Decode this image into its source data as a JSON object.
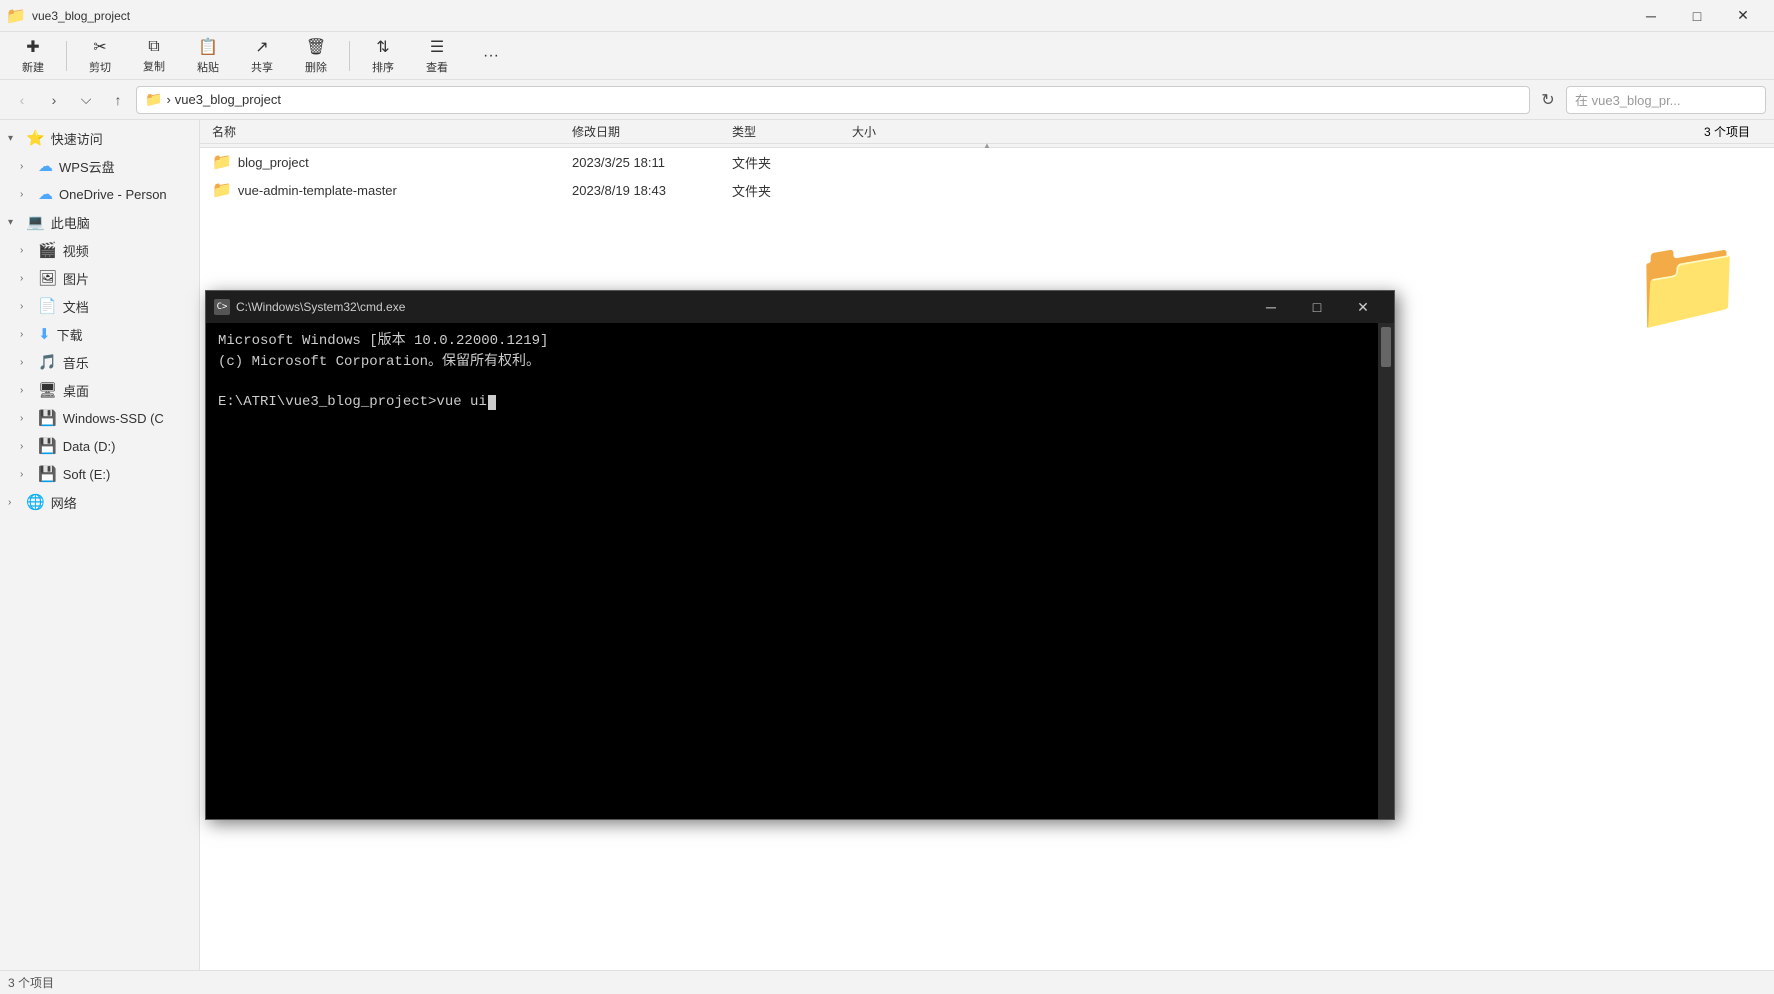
{
  "window": {
    "title": "vue3_blog_project",
    "titlebar_icon": "📁"
  },
  "toolbar": {
    "new_label": "新建",
    "cut_label": "剪切",
    "copy_label": "复制",
    "paste_label": "粘贴",
    "share_label": "共享",
    "delete_label": "删除",
    "sort_label": "排序",
    "view_label": "查看",
    "more_label": "..."
  },
  "addressbar": {
    "folder_icon": "📁",
    "separator": "›",
    "path": "vue3_blog_project",
    "search_placeholder": "在 vue3_blog_pr...",
    "refresh_icon": "↻"
  },
  "sidebar": {
    "items": [
      {
        "id": "quick-access",
        "label": "快速访问",
        "icon": "⭐",
        "expanded": true,
        "indent": 0
      },
      {
        "id": "wps",
        "label": "WPS云盘",
        "icon": "☁",
        "expanded": false,
        "indent": 1
      },
      {
        "id": "onedrive",
        "label": "OneDrive - Person",
        "icon": "☁",
        "expanded": false,
        "indent": 1
      },
      {
        "id": "this-pc",
        "label": "此电脑",
        "icon": "💻",
        "expanded": true,
        "indent": 0
      },
      {
        "id": "video",
        "label": "视频",
        "icon": "🎬",
        "expanded": false,
        "indent": 1
      },
      {
        "id": "pictures",
        "label": "图片",
        "icon": "🖼",
        "expanded": false,
        "indent": 1
      },
      {
        "id": "documents",
        "label": "文档",
        "icon": "📄",
        "expanded": false,
        "indent": 1
      },
      {
        "id": "downloads",
        "label": "下载",
        "icon": "⬇",
        "expanded": false,
        "indent": 1
      },
      {
        "id": "music",
        "label": "音乐",
        "icon": "🎵",
        "expanded": false,
        "indent": 1
      },
      {
        "id": "desktop",
        "label": "桌面",
        "icon": "🖥",
        "expanded": false,
        "indent": 1
      },
      {
        "id": "windows-ssd",
        "label": "Windows-SSD (C",
        "icon": "💾",
        "expanded": false,
        "indent": 1
      },
      {
        "id": "data-d",
        "label": "Data (D:)",
        "icon": "💾",
        "expanded": false,
        "indent": 1
      },
      {
        "id": "soft-e",
        "label": "Soft (E:)",
        "icon": "💾",
        "expanded": false,
        "indent": 1
      },
      {
        "id": "network",
        "label": "网络",
        "icon": "🌐",
        "expanded": false,
        "indent": 0
      }
    ]
  },
  "filearea": {
    "columns": {
      "name": "名称",
      "date": "修改日期",
      "type": "类型",
      "size": "大小",
      "count": "3 个项目"
    },
    "files": [
      {
        "name": "blog_project",
        "date": "2023/3/25 18:11",
        "type": "文件夹",
        "size": "",
        "icon": "📁"
      },
      {
        "name": "vue-admin-template-master",
        "date": "2023/8/19 18:43",
        "type": "文件夹",
        "size": "",
        "icon": "📁"
      }
    ]
  },
  "statusbar": {
    "text": "3 个项目"
  },
  "cmd": {
    "title": "C:\\Windows\\System32\\cmd.exe",
    "icon_text": "C>",
    "line1": "Microsoft Windows [版本 10.0.22000.1219]",
    "line2": "(c) Microsoft Corporation。保留所有权利。",
    "line3": "",
    "prompt": "E:\\ATRI\\vue3_blog_project>vue ui",
    "cursor": true
  }
}
